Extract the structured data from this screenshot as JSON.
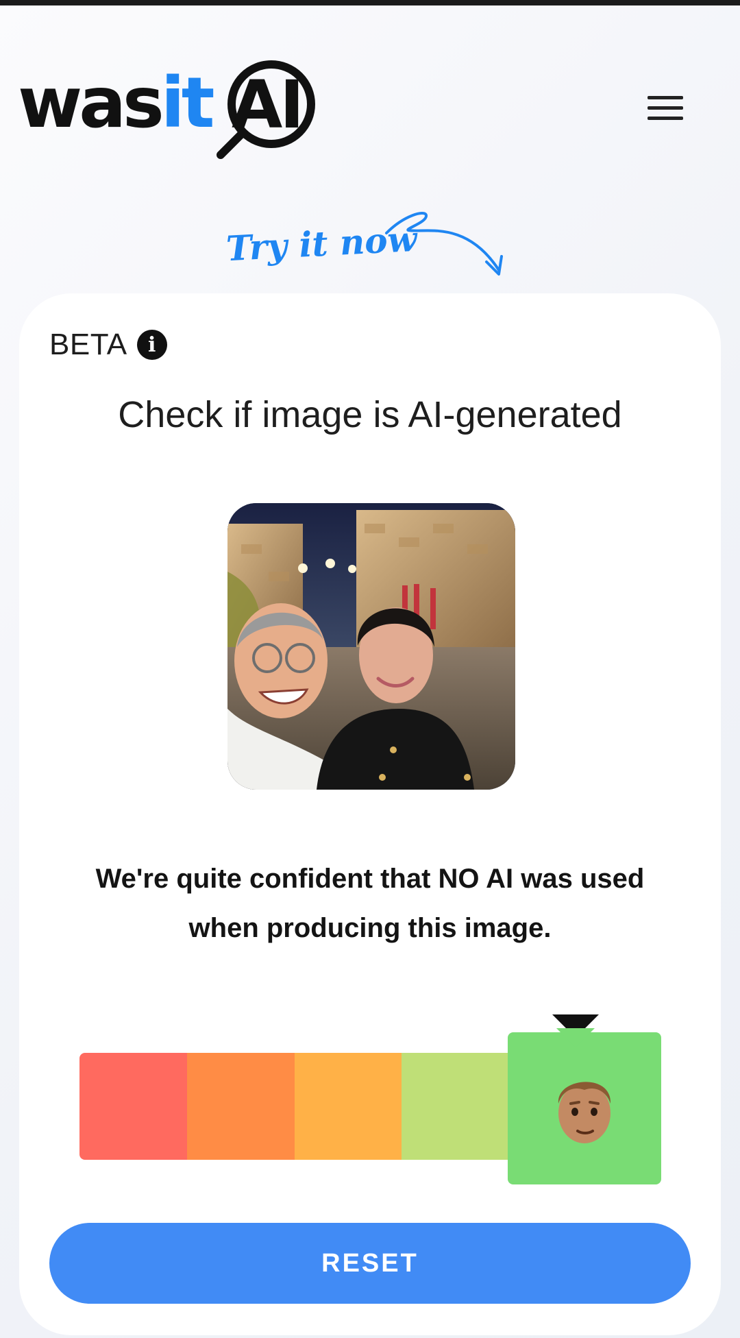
{
  "header": {
    "logo_word": "wasit",
    "logo_ai": "AI",
    "menu_icon": "hamburger-menu-icon"
  },
  "promo": {
    "try_now": "Try it now"
  },
  "card": {
    "beta_label": "BETA",
    "title": "Check if image is AI-generated",
    "result_text": "We're quite confident that NO AI was used when producing this image.",
    "meter": {
      "levels": 5,
      "selected_level": 5,
      "colors": [
        "#ff6a5f",
        "#ff8c45",
        "#ffb147",
        "#bfdf77",
        "#79dc74"
      ],
      "selected_icon": "human-face-icon"
    },
    "reset_label": "RESET"
  },
  "colors": {
    "brand_blue": "#1f86f2",
    "button_blue": "#418bf5"
  }
}
